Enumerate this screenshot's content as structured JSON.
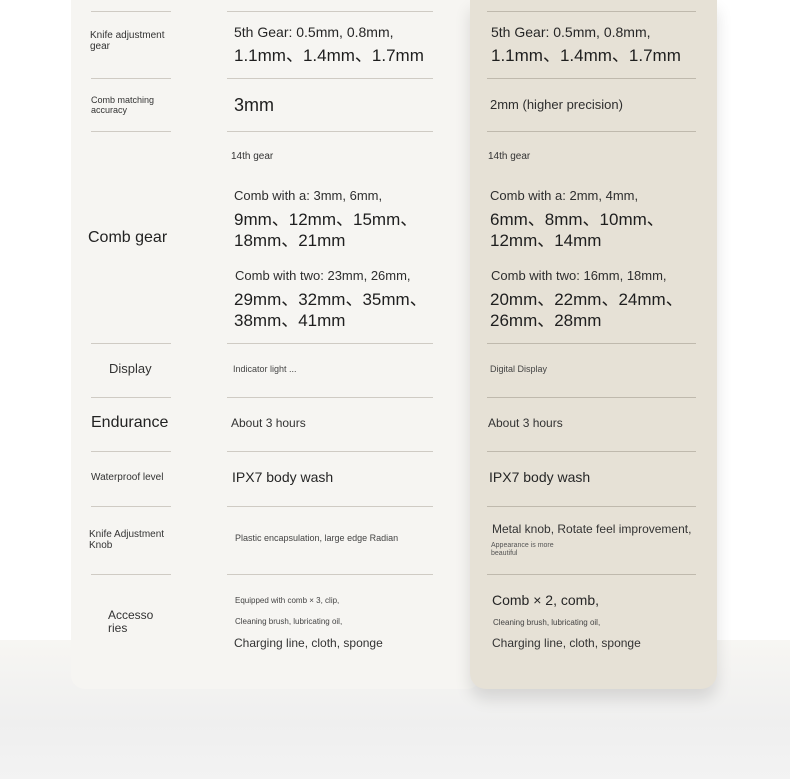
{
  "rows": {
    "knife_gear": {
      "label": "Knife adjustment gear",
      "left_line1": "5th Gear: 0.5mm, 0.8mm,",
      "left_line2": "1.1mm、1.4mm、1.7mm",
      "right_line1": "5th Gear: 0.5mm, 0.8mm,",
      "right_line2": "1.1mm、1.4mm、1.7mm"
    },
    "comb_accuracy": {
      "label": "Comb matching accuracy",
      "left": "3mm",
      "right": "2mm (higher precision)"
    },
    "comb_gear": {
      "label": "Comb gear",
      "left_head": "14th gear",
      "left_a1": "Comb with a: 3mm, 6mm,",
      "left_a2": "9mm、12mm、15mm、",
      "left_a3": "18mm、21mm",
      "left_b1": "Comb with two: 23mm, 26mm,",
      "left_b2": "29mm、32mm、35mm、",
      "left_b3": "38mm、41mm",
      "right_head": "14th gear",
      "right_a1": "Comb with a: 2mm, 4mm,",
      "right_a2": "6mm、8mm、10mm、",
      "right_a3": "12mm、14mm",
      "right_b1": "Comb with two: 16mm, 18mm,",
      "right_b2": "20mm、22mm、24mm、",
      "right_b3": "26mm、28mm"
    },
    "display": {
      "label": "Display",
      "left": "Indicator light ...",
      "right": "Digital Display"
    },
    "endurance": {
      "label": "Endurance",
      "left": "About 3 hours",
      "right": "About 3 hours"
    },
    "waterproof": {
      "label": "Waterproof level",
      "left": "IPX7 body wash",
      "right": "IPX7 body wash"
    },
    "knob": {
      "label": "Knife Adjustment Knob",
      "left": "Plastic encapsulation, large edge Radian",
      "right_line1": "Metal knob, Rotate feel improvement,",
      "right_line2": "Appearance is more beautiful"
    },
    "accessories": {
      "label_line1": "Accesso",
      "label_line2": "ries",
      "left_line1": "Equipped with comb × 3, clip,",
      "left_line2": "Cleaning brush, lubricating oil,",
      "left_line3": "Charging line, cloth, sponge",
      "right_line1": "Comb × 2, comb,",
      "right_line2": "Cleaning brush, lubricating oil,",
      "right_line3": "Charging line, cloth, sponge"
    }
  }
}
